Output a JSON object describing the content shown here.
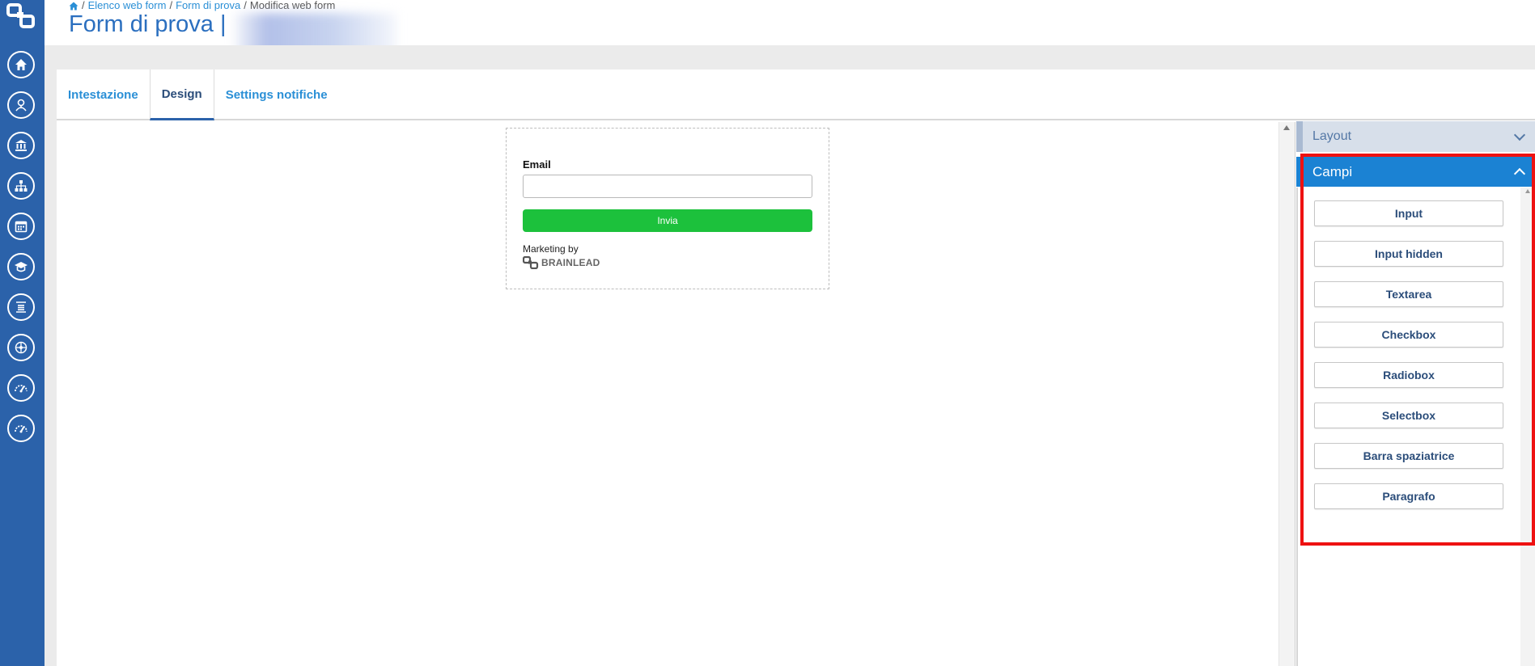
{
  "breadcrumb": {
    "home_icon": "home-icon",
    "items": [
      "Elenco web form",
      "Form di prova",
      "Modifica web form"
    ],
    "separator": "/"
  },
  "page": {
    "title": "Form di prova",
    "title_separator": "|"
  },
  "sidebar": {
    "icons": [
      "home-icon",
      "user-icon",
      "bank-icon",
      "org-chart-icon",
      "calendar-icon",
      "graduation-icon",
      "list-icon",
      "network-icon",
      "gauge-icon",
      "gauge-icon"
    ]
  },
  "tabs": [
    {
      "label": "Intestazione",
      "active": false
    },
    {
      "label": "Design",
      "active": true
    },
    {
      "label": "Settings notifiche",
      "active": false
    }
  ],
  "form_preview": {
    "email_label": "Email",
    "submit_label": "Invia",
    "marketing_text": "Marketing by",
    "brand_name": "BRAINLEAD"
  },
  "panel": {
    "layout_label": "Layout",
    "campi_label": "Campi",
    "fields": [
      "Input",
      "Input hidden",
      "Textarea",
      "Checkbox",
      "Radiobox",
      "Selectbox",
      "Barra spaziatrice",
      "Paragrafo"
    ]
  },
  "colors": {
    "sidebar": "#2b62aa",
    "accent": "#1b82d3",
    "submit": "#1cc13c",
    "highlight": "#ee1111"
  }
}
